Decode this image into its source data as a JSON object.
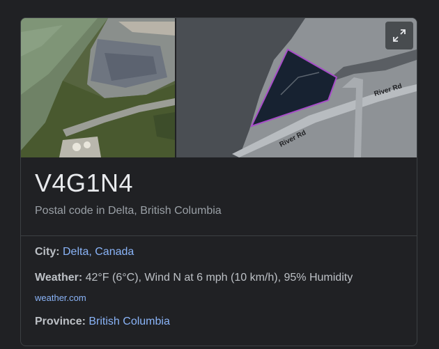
{
  "card": {
    "title": "V4G1N4",
    "subtitle": "Postal code in Delta, British Columbia"
  },
  "map": {
    "road_label_1": "River Rd",
    "road_label_2": "River Rd",
    "expand_icon": "expand-icon"
  },
  "facts": {
    "city_label": "City:",
    "city_value": "Delta, Canada",
    "weather_label": "Weather:",
    "weather_value": "42°F (6°C), Wind N at 6 mph (10 km/h), 95% Humidity",
    "weather_source": "weather.com",
    "province_label": "Province:",
    "province_value": "British Columbia"
  },
  "colors": {
    "link": "#8ab4f8",
    "background": "#202124",
    "boundary": "#a64cc8"
  }
}
